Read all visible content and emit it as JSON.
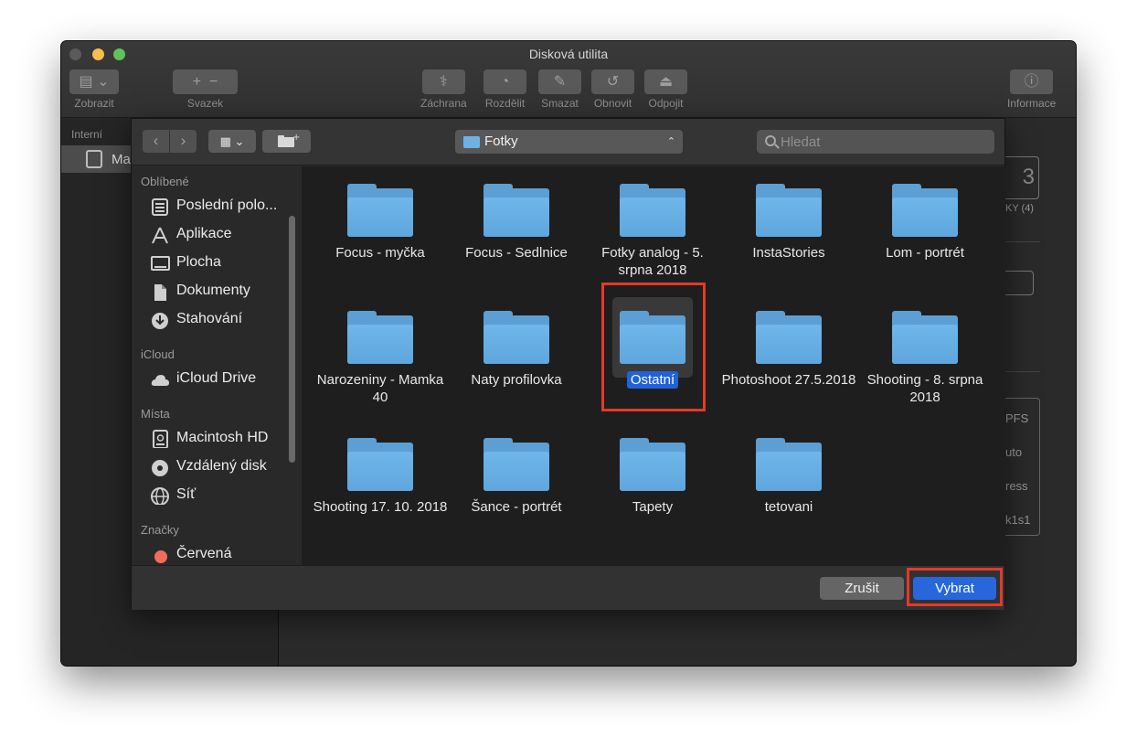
{
  "window": {
    "title": "Disková utilita",
    "toolbar": {
      "zobrazit": "Zobrazit",
      "svazek": "Svazek",
      "zachrana": "Záchrana",
      "rozdelit": "Rozdělit",
      "smazat": "Smazat",
      "obnovit": "Obnovit",
      "odpojit": "Odpojit",
      "informace": "Informace"
    },
    "sidebar": {
      "section": "Interní",
      "selected_item": "Ma"
    },
    "right_panel": {
      "digit": "3",
      "caption": "KY (4)",
      "rows": [
        "PFS",
        "uto",
        "ress",
        "k1s1"
      ]
    }
  },
  "dialog": {
    "location": "Fotky",
    "search_placeholder": "Hledat",
    "sidebar": {
      "sections": [
        {
          "title": "Oblíbené",
          "items": [
            {
              "label": "Poslední polo...",
              "icon": "recents-icon"
            },
            {
              "label": "Aplikace",
              "icon": "applications-icon"
            },
            {
              "label": "Plocha",
              "icon": "desktop-icon"
            },
            {
              "label": "Dokumenty",
              "icon": "documents-icon"
            },
            {
              "label": "Stahování",
              "icon": "downloads-icon"
            }
          ]
        },
        {
          "title": "iCloud",
          "items": [
            {
              "label": "iCloud Drive",
              "icon": "cloud-icon"
            }
          ]
        },
        {
          "title": "Místa",
          "items": [
            {
              "label": "Macintosh HD",
              "icon": "hard-drive-icon"
            },
            {
              "label": "Vzdálený disk",
              "icon": "optical-disk-icon"
            },
            {
              "label": "Síť",
              "icon": "network-icon"
            }
          ]
        },
        {
          "title": "Značky",
          "items": [
            {
              "label": "Červená",
              "icon": "red-tag-icon"
            }
          ]
        }
      ]
    },
    "folders": [
      {
        "name": "Focus - myčka",
        "selected": false
      },
      {
        "name": "Focus - Sedlnice",
        "selected": false
      },
      {
        "name": "Fotky analog - 5. srpna 2018",
        "selected": false
      },
      {
        "name": "InstaStories",
        "selected": false
      },
      {
        "name": "Lom - portrét",
        "selected": false
      },
      {
        "name": "Narozeniny - Mamka 40",
        "selected": false
      },
      {
        "name": "Naty profilovka",
        "selected": false
      },
      {
        "name": "Ostatní",
        "selected": true
      },
      {
        "name": "Photoshoot 27.5.2018",
        "selected": false
      },
      {
        "name": "Shooting - 8. srpna 2018",
        "selected": false
      },
      {
        "name": "Shooting 17. 10. 2018",
        "selected": false
      },
      {
        "name": "Šance - portrét",
        "selected": false
      },
      {
        "name": "Tapety",
        "selected": false
      },
      {
        "name": "tetovani",
        "selected": false
      }
    ],
    "buttons": {
      "cancel": "Zrušit",
      "choose": "Vybrat"
    },
    "colors": {
      "accent": "#2767db",
      "highlight": "#e23a2a",
      "folder": "#5ea6dc",
      "tag_red": "#f26b5b"
    }
  }
}
